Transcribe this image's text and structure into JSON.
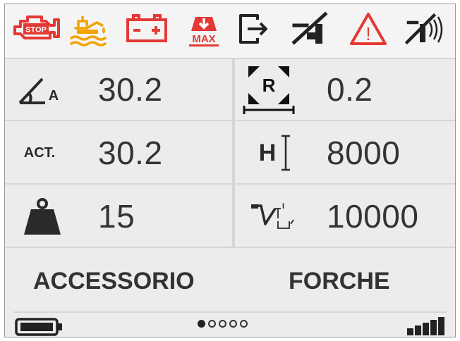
{
  "warning_icons": [
    {
      "name": "engine-stop-icon",
      "text": "STOP",
      "color": "#e53935"
    },
    {
      "name": "oil-level-icon",
      "color": "#f2a300"
    },
    {
      "name": "battery-warning-icon",
      "color": "#e53935"
    },
    {
      "name": "max-load-icon",
      "text": "MAX",
      "color": "#e53935"
    },
    {
      "name": "exit-arrow-icon",
      "color": "#222222"
    },
    {
      "name": "mast-tilt-icon",
      "color": "#222222"
    },
    {
      "name": "general-warning-icon",
      "text": "!",
      "color": "#e53935"
    },
    {
      "name": "sensor-signal-icon",
      "color": "#222222"
    }
  ],
  "cells": {
    "angle_value": "30.2",
    "radius_value": "0.2",
    "act_label": "ACT.",
    "act_value": "30.2",
    "height_label": "H",
    "height_value": "8000",
    "load_value": "15",
    "capacity_value": "10000"
  },
  "icon_texts": {
    "angle_a": "A",
    "radius_r": "R"
  },
  "accessories": {
    "left": "ACCESSORIO",
    "right": "FORCHE"
  },
  "status": {
    "page_total": 5,
    "page_active": 1,
    "battery_level": 1.0,
    "signal_level": 1.0
  },
  "colors": {
    "red": "#e53935",
    "amber": "#f2a300",
    "dark": "#222222"
  }
}
